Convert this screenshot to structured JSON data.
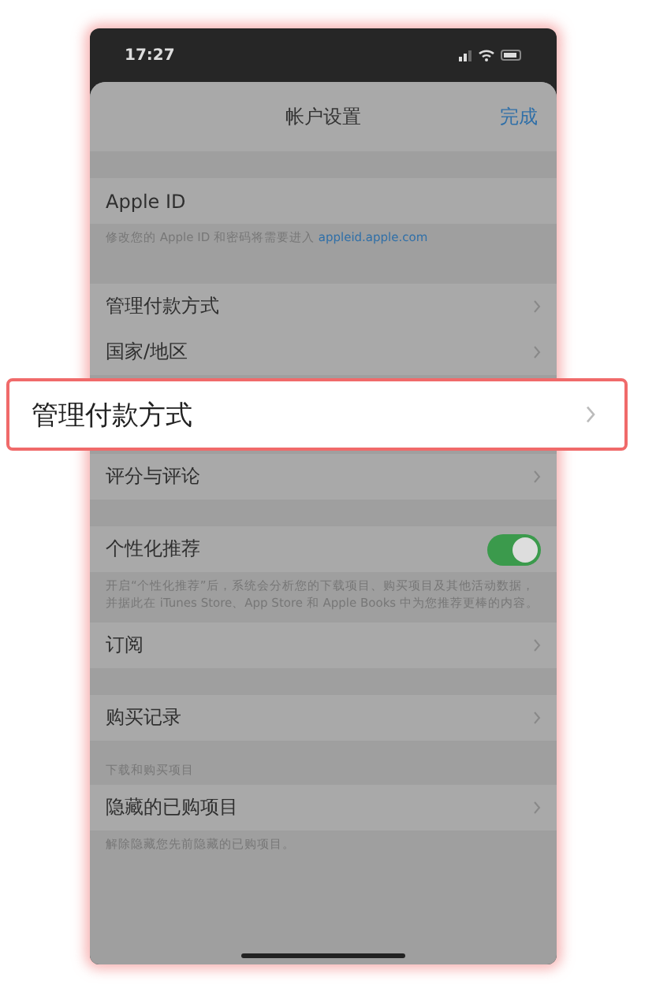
{
  "status_bar": {
    "time": "17:27"
  },
  "nav": {
    "title": "帐户设置",
    "action": "完成"
  },
  "items": [
    {
      "kind": "gap"
    },
    {
      "kind": "row",
      "label": "Apple ID",
      "chevron": false
    },
    {
      "kind": "note",
      "text": "修改您的 Apple ID 和密码将需要进入 ",
      "link": "appleid.apple.com"
    },
    {
      "kind": "gap"
    },
    {
      "kind": "row",
      "label": "管理付款方式"
    },
    {
      "kind": "row",
      "label": "国家/地区"
    },
    {
      "kind": "spacer"
    },
    {
      "kind": "row",
      "label": "评分与评论"
    },
    {
      "kind": "gap"
    },
    {
      "kind": "toggle",
      "label": "个性化推荐",
      "on": true
    },
    {
      "kind": "note",
      "text": "开启“个性化推荐”后，系统会分析您的下载项目、购买项目及其他活动数据，并据此在 iTunes Store、App Store 和 Apple Books 中为您推荐更棒的内容。"
    },
    {
      "kind": "row",
      "label": "订阅"
    },
    {
      "kind": "gap"
    },
    {
      "kind": "row",
      "label": "购买记录"
    },
    {
      "kind": "header",
      "text": "下载和购买项目"
    },
    {
      "kind": "row",
      "label": "隐藏的已购项目"
    },
    {
      "kind": "note",
      "text": "解除隐藏您先前隐藏的已购项目。"
    }
  ],
  "callout": {
    "label": "管理付款方式"
  }
}
